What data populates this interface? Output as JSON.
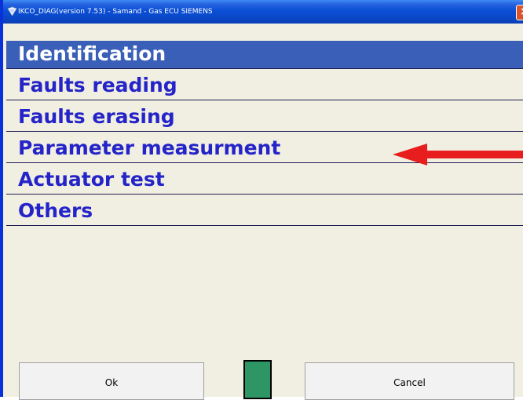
{
  "window": {
    "title": "IKCO_DIAG(version 7.53) - Samand - Gas ECU SIEMENS",
    "close_glyph": "×"
  },
  "menu": {
    "items": [
      {
        "label": "Identification",
        "selected": true
      },
      {
        "label": "Faults reading",
        "selected": false
      },
      {
        "label": "Faults erasing",
        "selected": false
      },
      {
        "label": "Parameter measurment",
        "selected": false
      },
      {
        "label": "Actuator test",
        "selected": false
      },
      {
        "label": "Others",
        "selected": false
      }
    ]
  },
  "buttons": {
    "ok_label": "Ok",
    "cancel_label": "Cancel"
  },
  "colors": {
    "selected_bg": "#3a5fb8",
    "label_color": "#2424c8",
    "arrow": "#e81e1e",
    "indicator": "#2e9665",
    "titlebar": "#0a4fd6"
  }
}
